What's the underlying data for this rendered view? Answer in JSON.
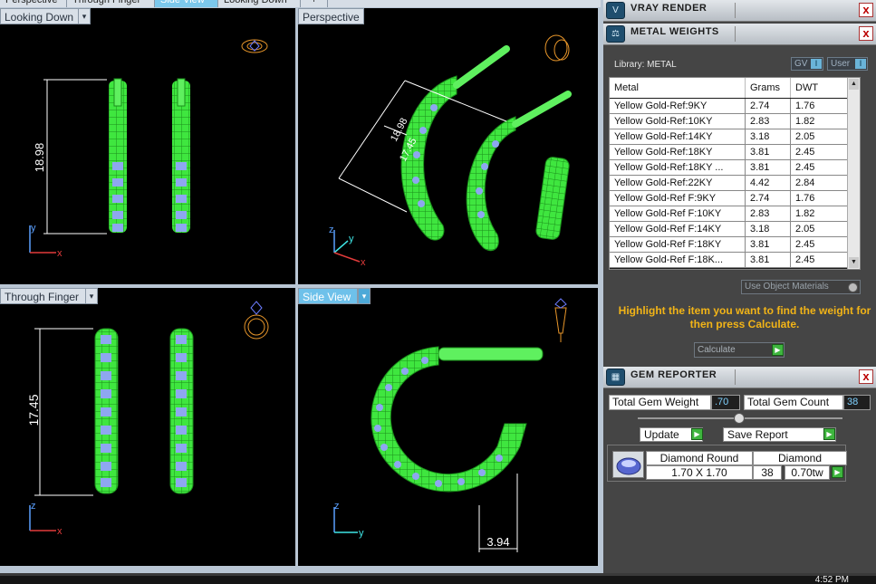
{
  "tabs": [
    "Perspective",
    "Through Finger",
    "Side View",
    "Looking Down",
    "+"
  ],
  "active_tab": "Side View",
  "viewports": {
    "looking_down": {
      "label": "Looking Down",
      "arrow": "▾",
      "dimension": "18.98",
      "axis_y": "y",
      "axis_x": "x"
    },
    "perspective": {
      "label": "Perspective",
      "arrow": "▾",
      "dimension_a": "18.98",
      "dimension_b": "17.45",
      "axis_z": "z",
      "axis_y": "y",
      "axis_x": "x"
    },
    "through_finger": {
      "label": "Through Finger",
      "arrow": "▾",
      "dimension": "17.45",
      "axis_z": "z",
      "axis_x": "x"
    },
    "side_view": {
      "label": "Side View",
      "arrow": "▾",
      "dimension": "3.94",
      "axis_z": "z",
      "axis_y": "y"
    }
  },
  "vray": {
    "title": "VRAY RENDER",
    "close": "x"
  },
  "metal": {
    "title": "METAL WEIGHTS",
    "close": "x",
    "library_label": "Library: METAL",
    "toggle_gv": "GV",
    "toggle_user": "User",
    "columns": [
      "Metal",
      "Grams",
      "DWT"
    ],
    "rows": [
      [
        "Yellow Gold-Ref:9KY",
        "2.74",
        "1.76"
      ],
      [
        "Yellow Gold-Ref:10KY",
        "2.83",
        "1.82"
      ],
      [
        "Yellow Gold-Ref:14KY",
        "3.18",
        "2.05"
      ],
      [
        "Yellow Gold-Ref:18KY",
        "3.81",
        "2.45"
      ],
      [
        "Yellow Gold-Ref:18KY ...",
        "3.81",
        "2.45"
      ],
      [
        "Yellow Gold-Ref:22KY",
        "4.42",
        "2.84"
      ],
      [
        "Yellow Gold-Ref F:9KY",
        "2.74",
        "1.76"
      ],
      [
        "Yellow Gold-Ref F:10KY",
        "2.83",
        "1.82"
      ],
      [
        "Yellow Gold-Ref F:14KY",
        "3.18",
        "2.05"
      ],
      [
        "Yellow Gold-Ref F:18KY",
        "3.81",
        "2.45"
      ],
      [
        "Yellow Gold-Ref F:18K...",
        "3.81",
        "2.45"
      ]
    ],
    "use_object_materials": "Use Object Materials",
    "hint": "Highlight the item you want to find the weight for then press Calculate.",
    "calculate": "Calculate"
  },
  "gem": {
    "title": "GEM REPORTER",
    "close": "x",
    "total_weight_label": "Total Gem Weight",
    "total_weight_value": ".70",
    "total_count_label": "Total Gem Count",
    "total_count_value": "38",
    "update": "Update",
    "save_report": "Save Report",
    "shape": "Diamond Round",
    "material": "Diamond",
    "size": "1.70 X 1.70",
    "count": "38",
    "weight": "0.70tw"
  },
  "clock": "4:52 PM"
}
